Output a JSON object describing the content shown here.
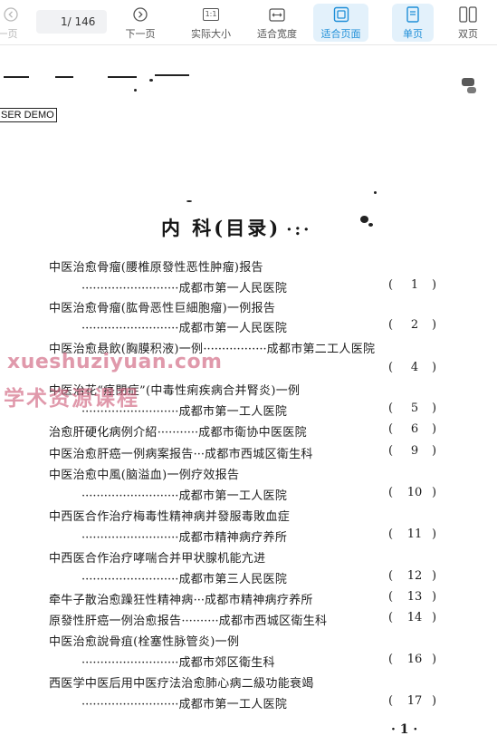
{
  "toolbar": {
    "prev_label": "上一页",
    "page_current": "1",
    "page_total": "/ 146",
    "next_label": "下一页",
    "actual_size_label": "实际大小",
    "actual_size_icon_text": "1:1",
    "fit_width_label": "适合宽度",
    "fit_page_label": "适合页面",
    "single_label": "单页",
    "double_label": "双页",
    "active_color": "#1f8fd8"
  },
  "document": {
    "demo_text": "SER DEMO",
    "heading": "内 科(目录)",
    "entries": [
      {
        "title": "中医治愈骨瘤(腰椎原發性恶性肿瘤)报告",
        "org": "成都市第一人民医院",
        "page": "1"
      },
      {
        "title": "中医治愈骨瘤(肱骨恶性巨細胞瘤)一例报告",
        "org": "成都市第一人民医院",
        "page": "2"
      },
      {
        "title": "中医治愈悬飲(胸膜积液)一例",
        "org": "成都市第二工人医院",
        "page": "4"
      },
      {
        "title": "中医治花“痉閉症”(中毒性痢疾病合并腎炎)一例",
        "org": "成都市第一工人医院",
        "page": "5"
      },
      {
        "title": "治愈肝硬化病例介紹",
        "org": "成都市衛协中医医院",
        "page": "6"
      },
      {
        "title": "中医治愈肝癌一例病案报告",
        "org": "成都市西城区衛生科",
        "page": "9"
      },
      {
        "title": "中医治愈中風(脑溢血)一例疗效报告",
        "org": "成都市第一工人医院",
        "page": "10"
      },
      {
        "title": "中西医合作治疗梅毒性精神病并發服毒敗血症",
        "org": "成都市精神病疗养所",
        "page": "11"
      },
      {
        "title": "中西医合作治疗哮喘合并甲状腺机能亢进",
        "org": "成都市第三人民医院",
        "page": "12"
      },
      {
        "title": "牵牛子散治愈躁狂性精神病",
        "org": "成都市精神病疗养所",
        "page": "13"
      },
      {
        "title": "原發性肝癌一例治愈报告",
        "org": "成都市西城区衛生科",
        "page": "14"
      },
      {
        "title": "中医治愈說骨疽(栓塞性脉管炎)一例",
        "org": "成都市郊区衛生科",
        "page": "16"
      },
      {
        "title": "西医学中医后用中医疗法治愈肺心病二級功能衰竭",
        "org": "成都市第一工人医院",
        "page": "17"
      }
    ],
    "page_footer": "· 1 ·"
  },
  "watermark": {
    "line1": "xueshuziyuan.com",
    "line2": "学术资源课程"
  }
}
